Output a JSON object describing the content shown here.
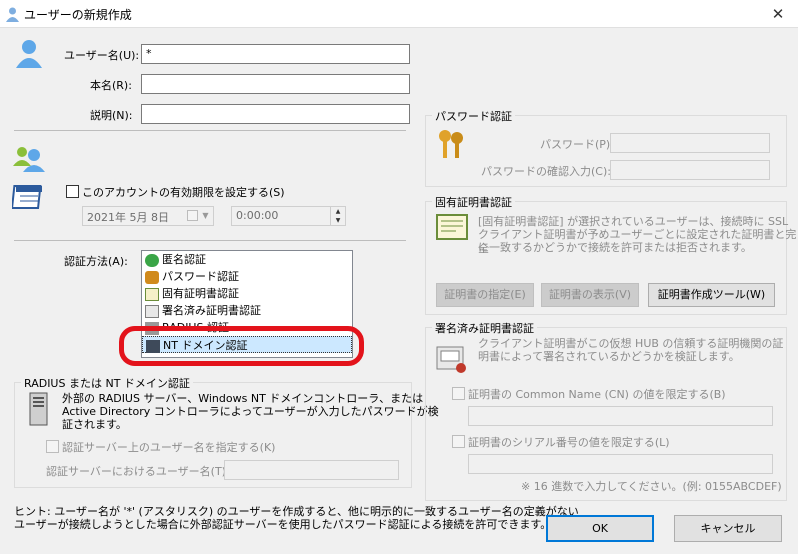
{
  "window": {
    "title": "ユーザーの新規作成",
    "close_glyph": "✕"
  },
  "fields": {
    "username_label": "ユーザー名(U):",
    "username_value": "*",
    "realname_label": "本名(R):",
    "realname_value": "",
    "description_label": "説明(N):",
    "description_value": ""
  },
  "expiry": {
    "checkbox_label": "このアカウントの有効期限を設定する(S)",
    "date_value": "2021年  5月  8日",
    "time_value": "0:00:00"
  },
  "auth": {
    "label": "認証方法(A):",
    "methods": [
      "匿名認証",
      "パスワード認証",
      "固有証明書認証",
      "署名済み証明書認証",
      "RADIUS 認証",
      "NT ドメイン認証"
    ],
    "selected": "NT ドメイン認証"
  },
  "radius": {
    "title": "RADIUS または NT ドメイン認証",
    "desc_line1": "外部の RADIUS サーバー、Windows NT ドメインコントローラ、または",
    "desc_line2": "Active Directory コントローラによってユーザーが入力したパスワードが検",
    "desc_line3": "証されます。",
    "specify_checkbox": "認証サーバー上のユーザー名を指定する(K)",
    "server_user_label": "認証サーバーにおけるユーザー名(T):",
    "server_user_value": ""
  },
  "password": {
    "title": "パスワード認証",
    "password_label": "パスワード(P):",
    "confirm_label": "パスワードの確認入力(C):"
  },
  "cert": {
    "title": "固有証明書認証",
    "desc_line1": "[固有証明書認証] が選択されているユーザーは、接続時に SSL",
    "desc_line2": "クライアント証明書が予めユーザーごとに設定された証明書と完全",
    "desc_line3": "に一致するかどうかで接続を許可または拒否されます。",
    "specify_button": "証明書の指定(E)",
    "view_button": "証明書の表示(V)",
    "tool_button": "証明書作成ツール(W)"
  },
  "signed": {
    "title": "署名済み証明書認証",
    "desc_line1": "クライアント証明書がこの仮想 HUB の信頼する証明機関の証",
    "desc_line2": "明書によって署名されているかどうかを検証します。",
    "cn_checkbox": "証明書の Common Name (CN) の値を限定する(B)",
    "serial_checkbox": "証明書のシリアル番号の値を限定する(L)",
    "hint": "※ 16 進数で入力してください。(例: 0155ABCDEF)"
  },
  "footer": {
    "hint_line1": "ヒント: ユーザー名が '*' (アスタリスク) のユーザーを作成すると、他に明示的に一致するユーザー名の定義がない",
    "hint_line2": "ユーザーが接続しようとした場合に外部認証サーバーを使用したパスワード認証による接続を許可できます。",
    "ok_button": "OK",
    "cancel_button": "キャンセル"
  },
  "colors": {
    "highlight_ring": "#e3131b",
    "accent": "#0078d7"
  }
}
